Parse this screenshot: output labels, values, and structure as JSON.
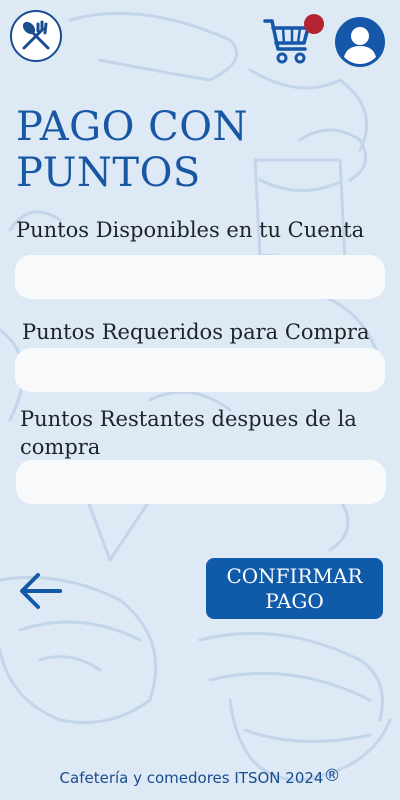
{
  "header": {
    "logo_icon": "fork-spoon-logo-icon",
    "cart_icon": "shopping-cart-icon",
    "cart_badge_color": "#b32430",
    "user_icon": "user-profile-icon"
  },
  "page": {
    "title": "PAGO CON PUNTOS"
  },
  "form": {
    "available_label": "Puntos Disponibles en tu Cuenta",
    "available_value": "",
    "required_label": "Puntos Requeridos para Compra",
    "required_value": "",
    "remaining_label": "Puntos Restantes despues de la compra",
    "remaining_value": ""
  },
  "actions": {
    "back_icon": "arrow-left-icon",
    "confirm_label": "CONFIRMAR PAGO"
  },
  "footer": {
    "text": "Cafetería y comedores ITSON 2024",
    "mark": "®"
  },
  "colors": {
    "background": "#dde9f5",
    "accent": "#0f5aa9",
    "title": "#1857a4"
  }
}
